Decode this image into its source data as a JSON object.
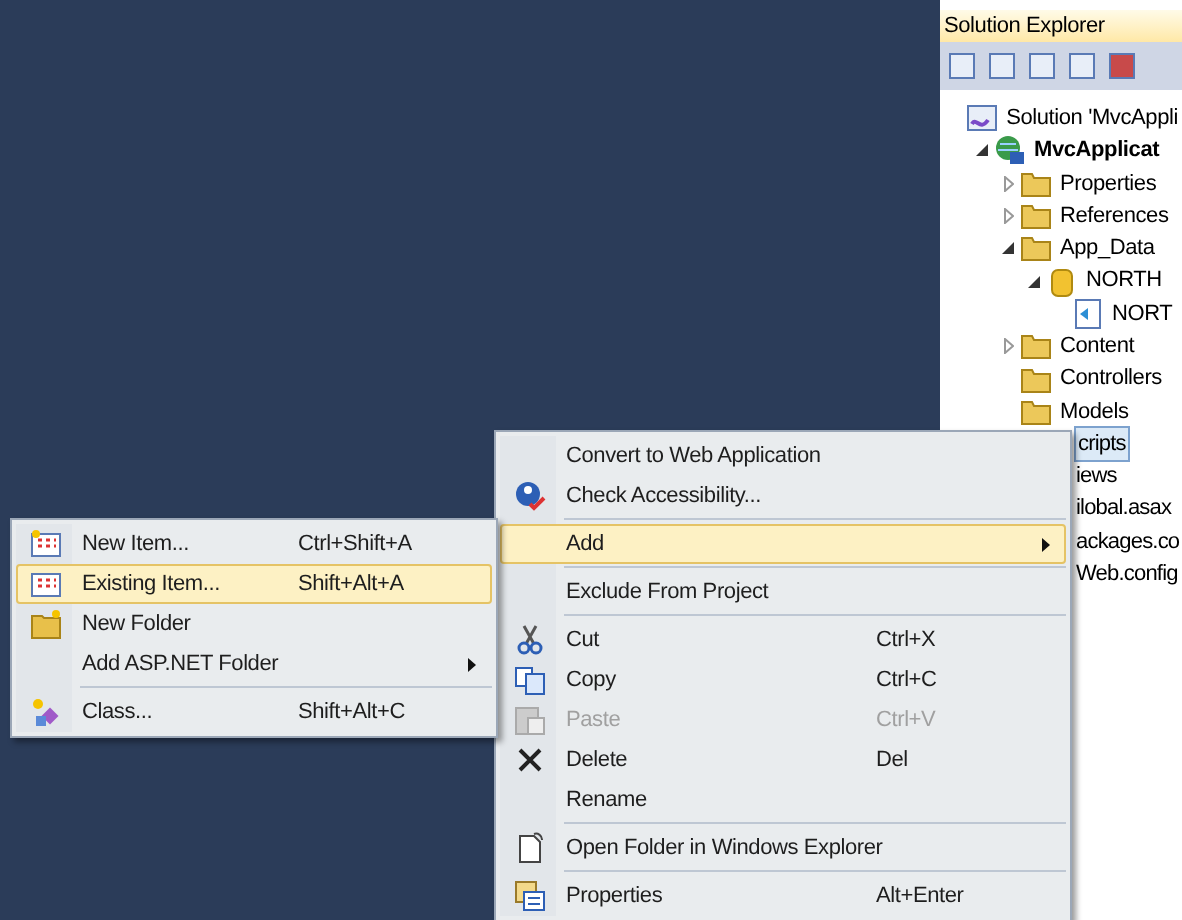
{
  "solution_explorer": {
    "title": "Solution Explorer",
    "tree": [
      {
        "label": "Solution 'MvcAppli",
        "bold": false,
        "selected": false,
        "children": [
          {
            "label": "MvcApplicat",
            "bold": true,
            "selected": false,
            "expanded": true,
            "children": [
              {
                "label": "Properties",
                "bold": false,
                "selected": false,
                "expanded": false
              },
              {
                "label": "References",
                "bold": false,
                "selected": false,
                "expanded": false
              },
              {
                "label": "App_Data",
                "bold": false,
                "selected": false,
                "expanded": true,
                "children": [
                  {
                    "label": "NORTH",
                    "bold": false,
                    "selected": false,
                    "expanded": true,
                    "children": [
                      {
                        "label": "NORT",
                        "bold": false,
                        "selected": false
                      }
                    ]
                  }
                ]
              },
              {
                "label": "Content",
                "bold": false,
                "selected": false,
                "expanded": false
              },
              {
                "label": "Controllers",
                "bold": false,
                "selected": false
              },
              {
                "label": "Models",
                "bold": false,
                "selected": false
              },
              {
                "label": "cripts",
                "bold": false,
                "selected": true,
                "covered": true
              },
              {
                "label": "iews",
                "bold": false,
                "selected": false,
                "covered": true
              },
              {
                "label": "ilobal.asax",
                "bold": false,
                "selected": false,
                "covered": true
              },
              {
                "label": "ackages.co",
                "bold": false,
                "selected": false,
                "covered": true
              },
              {
                "label": "Web.config",
                "bold": false,
                "selected": false,
                "covered": true
              }
            ]
          }
        ]
      }
    ]
  },
  "context_menu": [
    {
      "kind": "item",
      "label": "Convert to Web Application",
      "selected": false,
      "disabled": false
    },
    {
      "kind": "item",
      "label": "Check Accessibility...",
      "selected": false,
      "disabled": false
    },
    {
      "kind": "separator"
    },
    {
      "kind": "item",
      "label": "Add",
      "selected": true,
      "disabled": false,
      "submenu": true
    },
    {
      "kind": "separator"
    },
    {
      "kind": "item",
      "label": "Exclude From Project",
      "selected": false,
      "disabled": false
    },
    {
      "kind": "separator"
    },
    {
      "kind": "item",
      "label": "Cut",
      "shortcut": "Ctrl+X",
      "selected": false,
      "disabled": false
    },
    {
      "kind": "item",
      "label": "Copy",
      "shortcut": "Ctrl+C",
      "selected": false,
      "disabled": false
    },
    {
      "kind": "item",
      "label": "Paste",
      "shortcut": "Ctrl+V",
      "selected": false,
      "disabled": true
    },
    {
      "kind": "item",
      "label": "Delete",
      "shortcut": "Del",
      "selected": false,
      "disabled": false
    },
    {
      "kind": "item",
      "label": "Rename",
      "selected": false,
      "disabled": false
    },
    {
      "kind": "separator"
    },
    {
      "kind": "item",
      "label": "Open Folder in Windows Explorer",
      "selected": false,
      "disabled": false
    },
    {
      "kind": "separator"
    },
    {
      "kind": "item",
      "label": "Properties",
      "shortcut": "Alt+Enter",
      "selected": false,
      "disabled": false
    }
  ],
  "add_submenu": [
    {
      "kind": "item",
      "label": "New Item...",
      "shortcut": "Ctrl+Shift+A",
      "selected": false,
      "disabled": false
    },
    {
      "kind": "item",
      "label": "Existing Item...",
      "shortcut": "Shift+Alt+A",
      "selected": true,
      "disabled": false
    },
    {
      "kind": "item",
      "label": "New Folder",
      "selected": false,
      "disabled": false
    },
    {
      "kind": "item",
      "label": "Add ASP.NET Folder",
      "selected": false,
      "disabled": false,
      "submenu": true
    },
    {
      "kind": "separator"
    },
    {
      "kind": "item",
      "label": "Class...",
      "shortcut": "Shift+Alt+C",
      "selected": false,
      "disabled": false
    }
  ]
}
